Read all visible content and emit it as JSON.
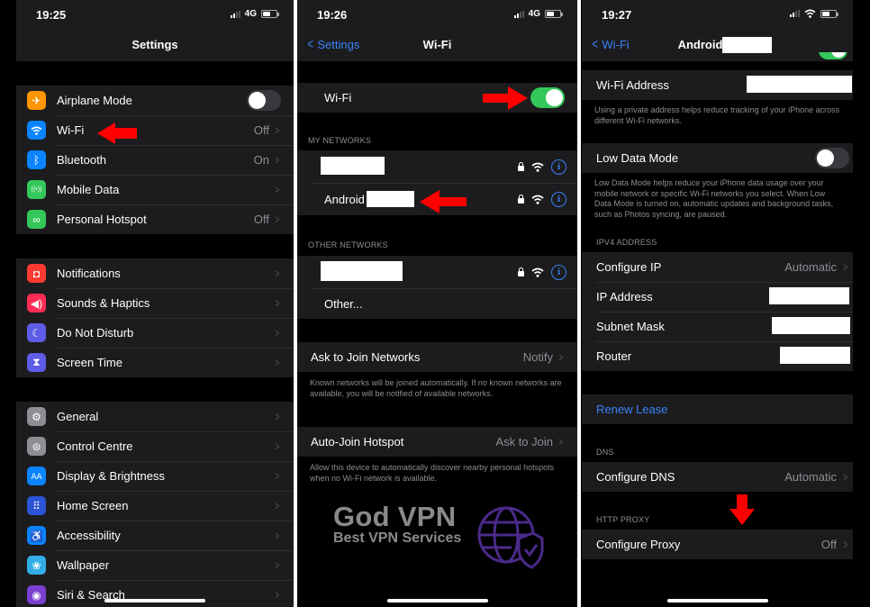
{
  "colors": {
    "accent": "#3a82f7",
    "toggle_on": "#34c759",
    "annotation_arrow": "#ff0000",
    "group_bg": "#1c1c1e",
    "secondary_text": "#8e8e93"
  },
  "panel1": {
    "status": {
      "time": "19:25",
      "network": "4G"
    },
    "title": "Settings",
    "groups": [
      [
        {
          "icon": "airplane-icon",
          "glyph": "✈",
          "color": "#ff9500",
          "label": "Airplane Mode",
          "toggle": false
        },
        {
          "icon": "wifi-icon",
          "glyph": "",
          "color": "#0a84ff",
          "label": "Wi-Fi",
          "value": "Off"
        },
        {
          "icon": "bluetooth-icon",
          "glyph": "ᛒ",
          "color": "#0a84ff",
          "label": "Bluetooth",
          "value": "On"
        },
        {
          "icon": "mobile-data-icon",
          "glyph": "((•))",
          "color": "#34c759",
          "label": "Mobile Data",
          "value": ""
        },
        {
          "icon": "personal-hotspot-icon",
          "glyph": "∞",
          "color": "#34c759",
          "label": "Personal Hotspot",
          "value": "Off"
        }
      ],
      [
        {
          "icon": "notifications-icon",
          "glyph": "◘",
          "color": "#ff3b30",
          "label": "Notifications"
        },
        {
          "icon": "sounds-icon",
          "glyph": "◀)",
          "color": "#ff2d55",
          "label": "Sounds & Haptics"
        },
        {
          "icon": "moon-icon",
          "glyph": "☾",
          "color": "#5e5ce6",
          "label": "Do Not Disturb"
        },
        {
          "icon": "hourglass-icon",
          "glyph": "⧗",
          "color": "#5e5ce6",
          "label": "Screen Time"
        }
      ],
      [
        {
          "icon": "gear-icon",
          "glyph": "⚙",
          "color": "#8e8e93",
          "label": "General"
        },
        {
          "icon": "control-centre-icon",
          "glyph": "⊜",
          "color": "#8e8e93",
          "label": "Control Centre"
        },
        {
          "icon": "display-icon",
          "glyph": "AA",
          "color": "#0a84ff",
          "label": "Display & Brightness"
        },
        {
          "icon": "home-screen-icon",
          "glyph": "⠿",
          "color": "#2c54d6",
          "label": "Home Screen"
        },
        {
          "icon": "accessibility-icon",
          "glyph": "♿",
          "color": "#0a84ff",
          "label": "Accessibility"
        },
        {
          "icon": "wallpaper-icon",
          "glyph": "❀",
          "color": "#32ade6",
          "label": "Wallpaper"
        },
        {
          "icon": "siri-icon",
          "glyph": "◉",
          "color": "#7a3fd1",
          "label": "Siri & Search"
        }
      ]
    ]
  },
  "panel2": {
    "status": {
      "time": "19:26",
      "network": "4G"
    },
    "back": "Settings",
    "title": "Wi-Fi",
    "wifi_label": "Wi-Fi",
    "wifi_on": true,
    "my_networks_header": "MY NETWORKS",
    "my_networks": [
      {
        "name": ""
      },
      {
        "name": "Android"
      }
    ],
    "other_networks_header": "OTHER NETWORKS",
    "other_networks": [
      {
        "name": ""
      }
    ],
    "other_label": "Other...",
    "ask_join": {
      "label": "Ask to Join Networks",
      "value": "Notify"
    },
    "ask_join_note": "Known networks will be joined automatically. If no known networks are available, you will be notified of available networks.",
    "auto_join": {
      "label": "Auto-Join Hotspot",
      "value": "Ask to Join"
    },
    "auto_join_note": "Allow this device to automatically discover nearby personal hotspots when no Wi-Fi network is available.",
    "watermark": {
      "title": "God VPN",
      "subtitle": "Best VPN Services"
    }
  },
  "panel3": {
    "status": {
      "time": "19:27"
    },
    "back": "Wi-Fi",
    "title": "Android",
    "wifi_address_label": "Wi-Fi Address",
    "private_note": "Using a private address helps reduce tracking of your iPhone across different Wi-Fi networks.",
    "low_data": {
      "label": "Low Data Mode",
      "on": false
    },
    "low_data_note": "Low Data Mode helps reduce your iPhone data usage over your mobile network or specific Wi-Fi networks you select. When Low Data Mode is turned on, automatic updates and background tasks, such as Photos syncing, are paused.",
    "ipv4_header": "IPV4 ADDRESS",
    "configure_ip": {
      "label": "Configure IP",
      "value": "Automatic"
    },
    "ip_address_label": "IP Address",
    "subnet_label": "Subnet Mask",
    "router_label": "Router",
    "renew_lease": "Renew Lease",
    "dns_header": "DNS",
    "configure_dns": {
      "label": "Configure DNS",
      "value": "Automatic"
    },
    "proxy_header": "HTTP PROXY",
    "configure_proxy": {
      "label": "Configure Proxy",
      "value": "Off"
    }
  }
}
